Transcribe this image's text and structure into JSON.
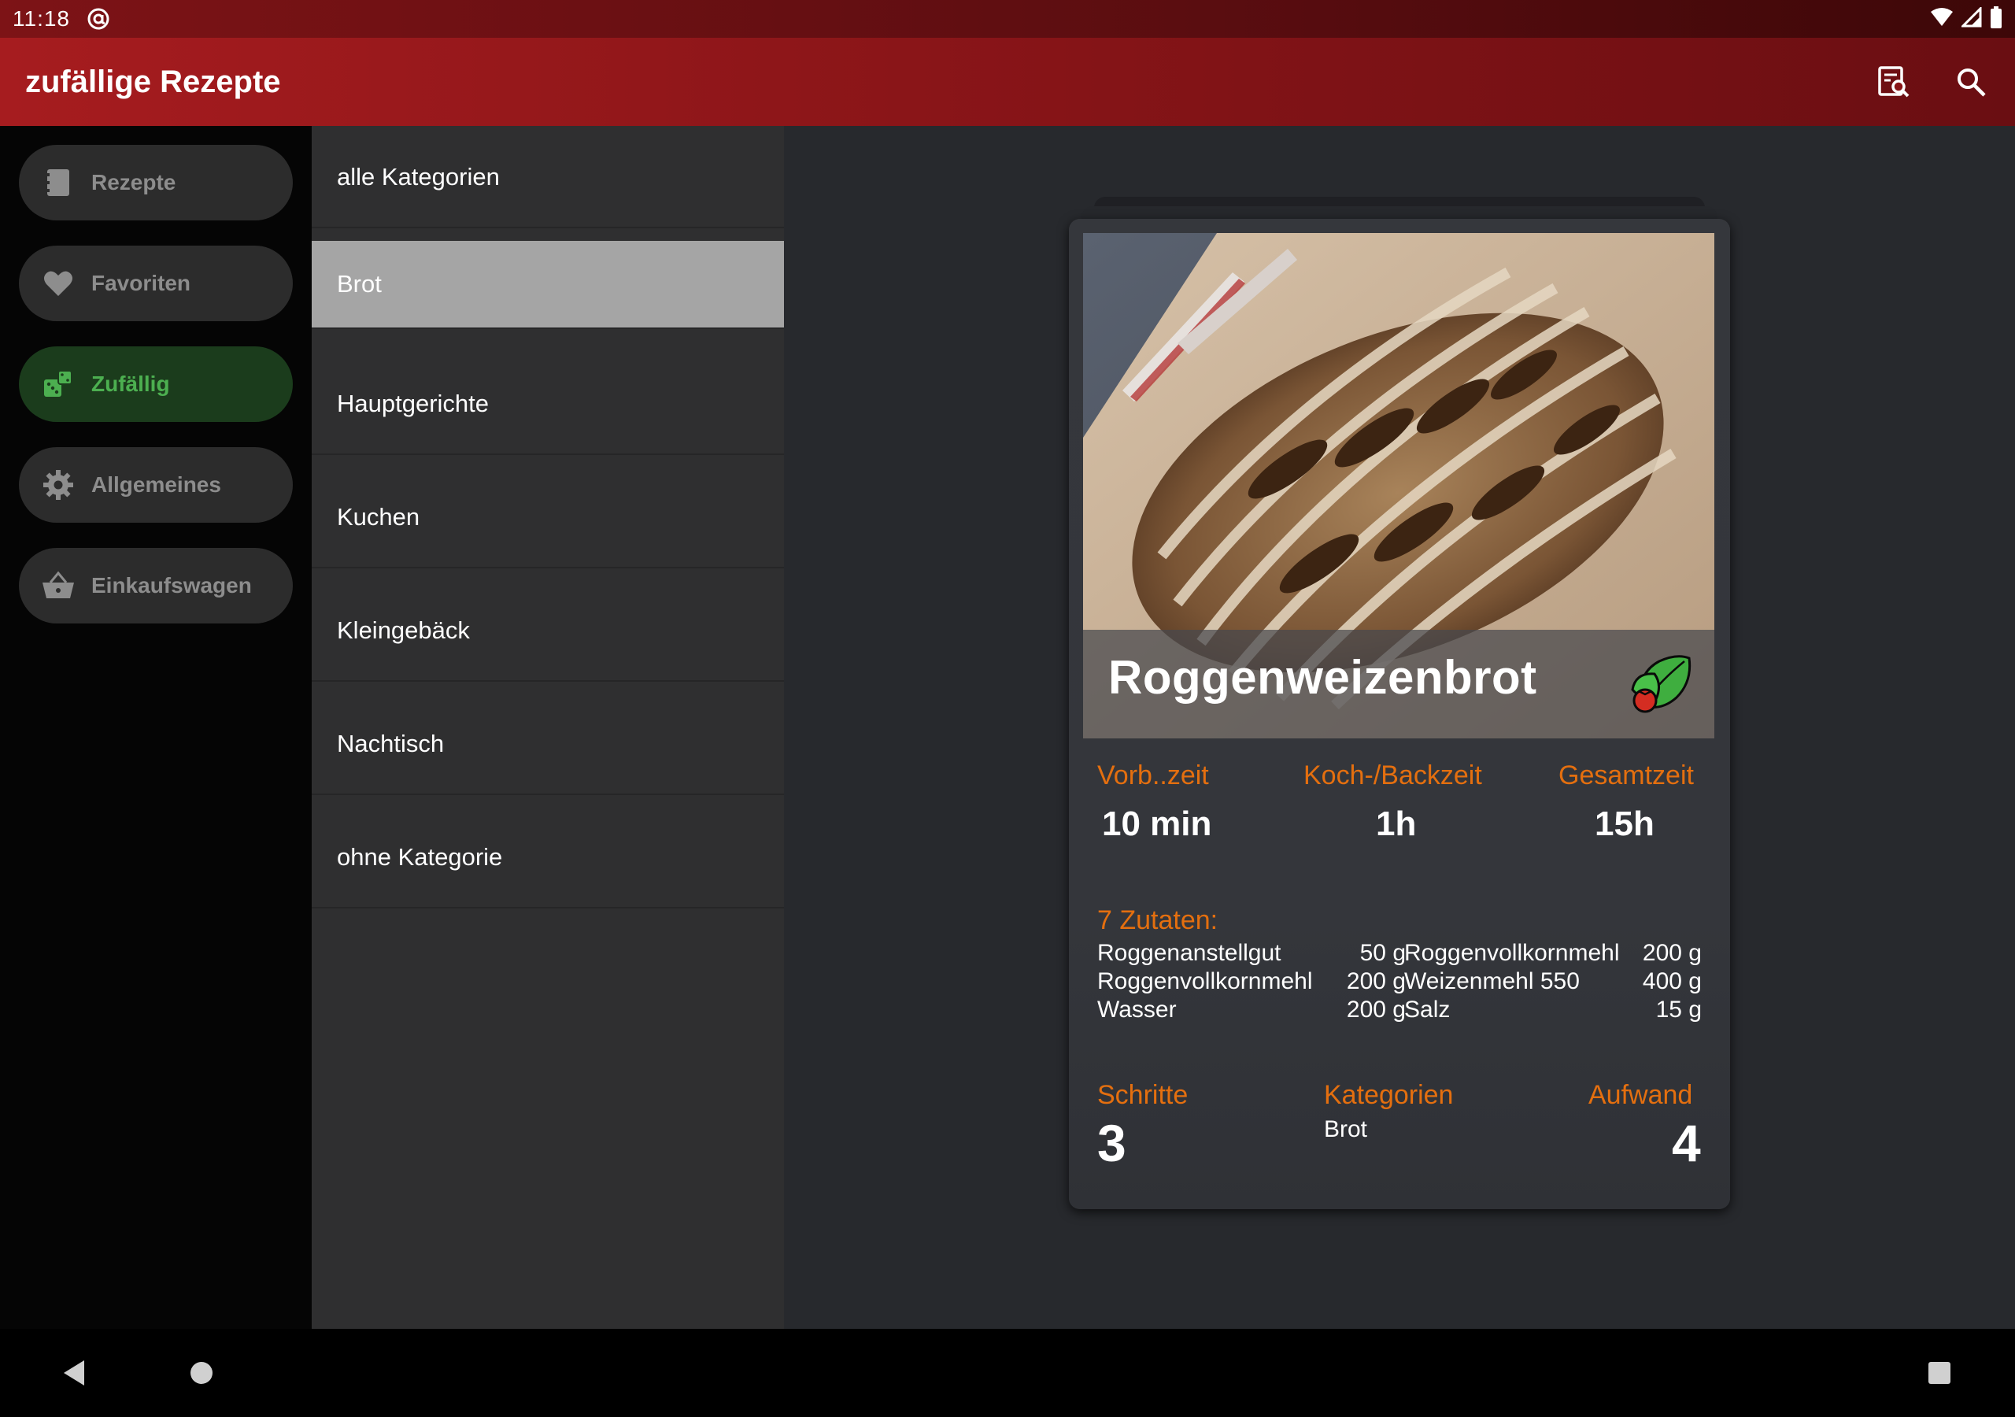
{
  "status_bar": {
    "time": "11:18"
  },
  "app_bar": {
    "title": "zufällige Rezepte",
    "actions": [
      {
        "icon": "recipe-search-icon"
      },
      {
        "icon": "search-icon"
      }
    ]
  },
  "nav": {
    "items": [
      {
        "label": "Rezepte",
        "icon": "book-icon",
        "active": false
      },
      {
        "label": "Favoriten",
        "icon": "heart-icon",
        "active": false
      },
      {
        "label": "Zufällig",
        "icon": "dice-icon",
        "active": true
      },
      {
        "label": "Allgemeines",
        "icon": "gear-icon",
        "active": false
      },
      {
        "label": "Einkaufswagen",
        "icon": "basket-icon",
        "active": false
      }
    ]
  },
  "categories": {
    "items": [
      "alle Kategorien",
      "Brot",
      "Hauptgerichte",
      "Kuchen",
      "Kleingebäck",
      "Nachtisch",
      "ohne Kategorie"
    ],
    "selected": "Brot"
  },
  "card": {
    "title": "Roggenweizenbrot",
    "veg_icon": "vegetarian-leaf-tomato-icon",
    "times": {
      "prep_label": "Vorb..zeit",
      "prep_value": "10 min",
      "cook_label": "Koch-/Backzeit",
      "cook_value": "1h",
      "total_label": "Gesamtzeit",
      "total_value": "15h"
    },
    "ingredients_label": "7 Zutaten:",
    "ingredients_left": [
      {
        "name": "Roggenanstellgut",
        "amount": "50 g"
      },
      {
        "name": "Roggenvollkornmehl",
        "amount": "200 g"
      },
      {
        "name": "Wasser",
        "amount": "200 g"
      }
    ],
    "ingredients_right": [
      {
        "name": "Roggenvollkornmehl",
        "amount": "200 g"
      },
      {
        "name": "Weizenmehl 550",
        "amount": "400 g"
      },
      {
        "name": "Salz",
        "amount": "15 g"
      }
    ],
    "steps_label": "Schritte",
    "steps_value": "3",
    "categories_label": "Kategorien",
    "categories_value": "Brot",
    "effort_label": "Aufwand",
    "effort_value": "4"
  },
  "colors": {
    "accent_orange": "#e46f0f",
    "app_bar_red": "#8a1518",
    "active_green": "#4caf50"
  }
}
